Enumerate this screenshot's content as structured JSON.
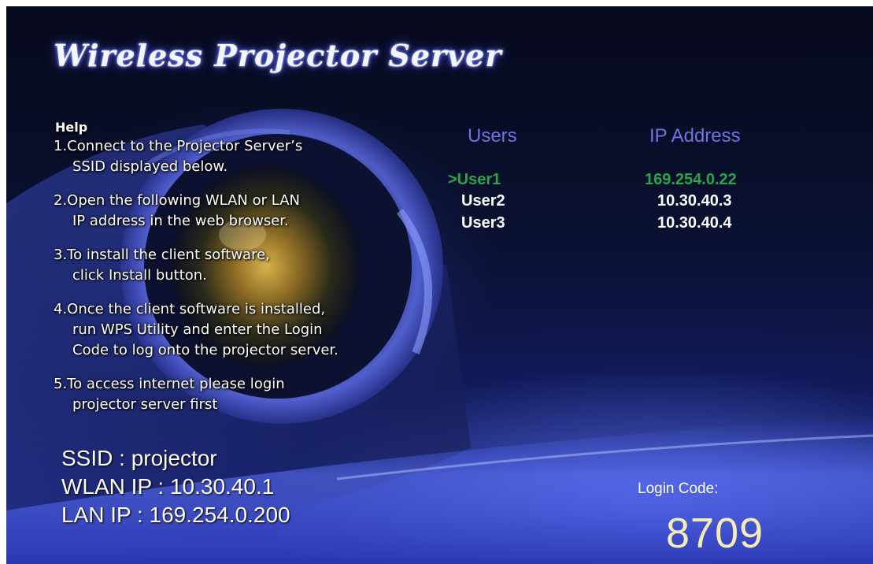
{
  "app": {
    "title": "Wireless Projector Server"
  },
  "help": {
    "heading": "Help",
    "steps": [
      {
        "line1": "1.Connect to the Projector Server’s",
        "line2": "SSID displayed below."
      },
      {
        "line1": "2.Open the following WLAN or LAN",
        "line2": "IP address in the web browser."
      },
      {
        "line1": "3.To install the client software,",
        "line2": "click Install button."
      },
      {
        "line1": "4.Once the client software is installed,",
        "line2": "run WPS Utility and enter the Login",
        "line3": "Code to log onto the projector server."
      },
      {
        "line1": "5.To access internet please login",
        "line2": "projector server first"
      }
    ]
  },
  "network": {
    "ssid": "SSID : projector",
    "wlan_ip": "WLAN IP : 10.30.40.1",
    "lan_ip": "LAN IP : 169.254.0.200"
  },
  "users_table": {
    "header_users": "Users",
    "header_ip": "IP Address",
    "rows": [
      {
        "user": ">User1",
        "ip": "169.254.0.22",
        "selected": true
      },
      {
        "user": "User2",
        "ip": "10.30.40.3",
        "selected": false
      },
      {
        "user": "User3",
        "ip": "10.30.40.4",
        "selected": false
      }
    ]
  },
  "login": {
    "label": "Login Code:",
    "code": "8709"
  },
  "colors": {
    "header_text": "#6f73e6",
    "selected_user": "#27a74a",
    "login_code": "#f4ecb4",
    "background_deep": "#070a1c",
    "background_glow": "#2a3ad0"
  }
}
